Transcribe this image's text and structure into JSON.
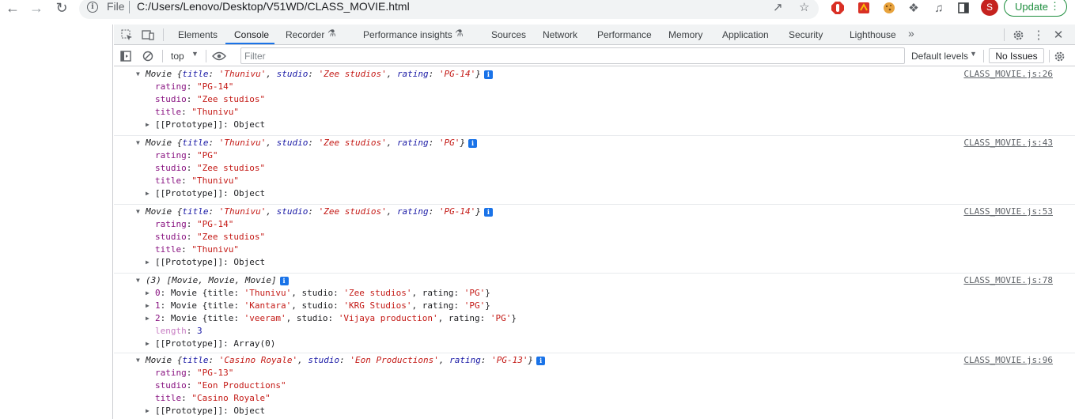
{
  "browser": {
    "file_label": "File",
    "url": "C:/Users/Lenovo/Desktop/V51WD/CLASS_MOVIE.html",
    "avatar_letter": "S",
    "update_label": "Update"
  },
  "devtools": {
    "tabs": [
      "Elements",
      "Console",
      "Recorder",
      "Performance insights",
      "Sources",
      "Network",
      "Performance",
      "Memory",
      "Application",
      "Security",
      "Lighthouse"
    ],
    "active_tab": "Console",
    "context": "top",
    "filter_placeholder": "Filter",
    "levels_label": "Default levels",
    "issues_label": "No Issues"
  },
  "console": {
    "entries": [
      {
        "source": "CLASS_MOVIE.js:26",
        "summary": {
          "cls": "Movie",
          "title": "'Thunivu'",
          "studio": "'Zee studios'",
          "rating": "'PG-14'"
        },
        "props": [
          {
            "key": "rating",
            "value": "\"PG-14\""
          },
          {
            "key": "studio",
            "value": "\"Zee studios\""
          },
          {
            "key": "title",
            "value": "\"Thunivu\""
          }
        ],
        "proto": "[[Prototype]]",
        "proto_value": "Object"
      },
      {
        "source": "CLASS_MOVIE.js:43",
        "summary": {
          "cls": "Movie",
          "title": "'Thunivu'",
          "studio": "'Zee studios'",
          "rating": "'PG'"
        },
        "props": [
          {
            "key": "rating",
            "value": "\"PG\""
          },
          {
            "key": "studio",
            "value": "\"Zee studios\""
          },
          {
            "key": "title",
            "value": "\"Thunivu\""
          }
        ],
        "proto": "[[Prototype]]",
        "proto_value": "Object"
      },
      {
        "source": "CLASS_MOVIE.js:53",
        "summary": {
          "cls": "Movie",
          "title": "'Thunivu'",
          "studio": "'Zee studios'",
          "rating": "'PG-14'"
        },
        "props": [
          {
            "key": "rating",
            "value": "\"PG-14\""
          },
          {
            "key": "studio",
            "value": "\"Zee studios\""
          },
          {
            "key": "title",
            "value": "\"Thunivu\""
          }
        ],
        "proto": "[[Prototype]]",
        "proto_value": "Object"
      }
    ],
    "array_entry": {
      "source": "CLASS_MOVIE.js:78",
      "summary": "(3) [Movie, Movie, Movie]",
      "items": [
        {
          "index": "0",
          "cls": "Movie",
          "title": "'Thunivu'",
          "studio": "'Zee studios'",
          "rating": "'PG'"
        },
        {
          "index": "1",
          "cls": "Movie",
          "title": "'Kantara'",
          "studio": "'KRG Studios'",
          "rating": "'PG'"
        },
        {
          "index": "2",
          "cls": "Movie",
          "title": "'veeram'",
          "studio": "'Vijaya production'",
          "rating": "'PG'"
        }
      ],
      "length_key": "length",
      "length_value": "3",
      "proto": "[[Prototype]]",
      "proto_value": "Array(0)"
    },
    "last_entry": {
      "source": "CLASS_MOVIE.js:96",
      "summary": {
        "cls": "Movie",
        "title": "'Casino Royale'",
        "studio": "'Eon Productions'",
        "rating": "'PG-13'"
      },
      "props": [
        {
          "key": "rating",
          "value": "\"PG-13\""
        },
        {
          "key": "studio",
          "value": "\"Eon Productions\""
        },
        {
          "key": "title",
          "value": "\"Casino Royale\""
        }
      ],
      "proto": "[[Prototype]]",
      "proto_value": "Object"
    }
  }
}
